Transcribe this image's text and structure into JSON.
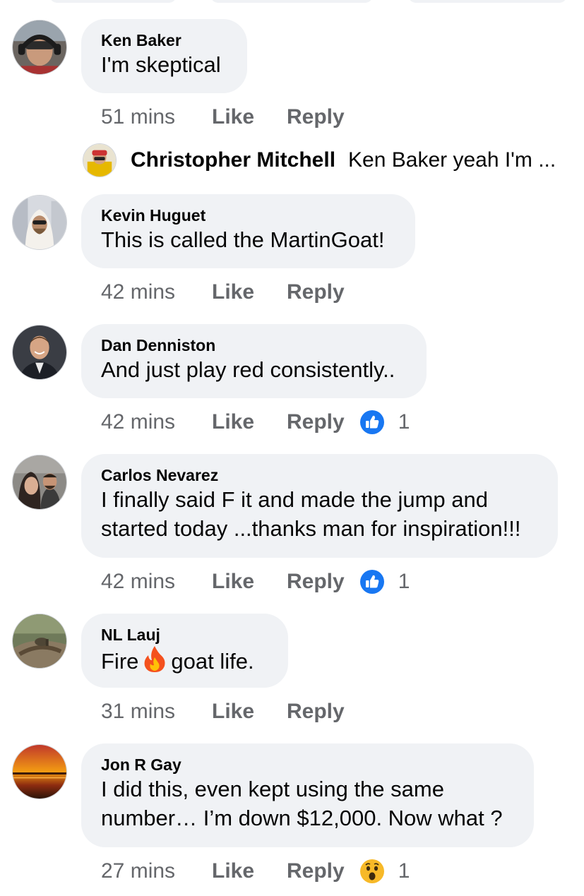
{
  "comments": [
    {
      "author": "Ken Baker",
      "text": "I'm skeptical",
      "time": "51 mins",
      "like_label": "Like",
      "reply_label": "Reply"
    },
    {
      "author": "Kevin Huguet",
      "text": "This is called the MartinGoat!",
      "time": "42 mins",
      "like_label": "Like",
      "reply_label": "Reply"
    },
    {
      "author": "Dan Denniston",
      "text": "And just play red consistently..",
      "time": "42 mins",
      "like_label": "Like",
      "reply_label": "Reply",
      "reaction": {
        "icon": "like-reaction-icon",
        "count": "1"
      }
    },
    {
      "author": "Carlos Nevarez",
      "text": "I finally said F it and made the jump and\nstarted today ...thanks man for inspiration!!!",
      "time": "42 mins",
      "like_label": "Like",
      "reply_label": "Reply",
      "reaction": {
        "icon": "like-reaction-icon",
        "count": "1"
      }
    },
    {
      "author": "NL Lauj",
      "text_before": "Fire",
      "emoji": "fire-emoji-icon",
      "text_after": "goat life.",
      "time": "31 mins",
      "like_label": "Like",
      "reply_label": "Reply"
    },
    {
      "author": "Jon R Gay",
      "text": "I did this, even kept using the same\nnumber… I’m down $12,000. Now what ?",
      "time": "27 mins",
      "like_label": "Like",
      "reply_label": "Reply",
      "reaction": {
        "icon": "wow-reaction-icon",
        "count": "1"
      }
    }
  ],
  "reply_preview": {
    "author": "Christopher Mitchell",
    "text": "Ken Baker yeah I'm ..."
  },
  "colors": {
    "bubble": "#f0f2f5",
    "meta_text": "#65676b",
    "like_blue": "#1877f2",
    "wow_yellow": "#f7b928"
  }
}
